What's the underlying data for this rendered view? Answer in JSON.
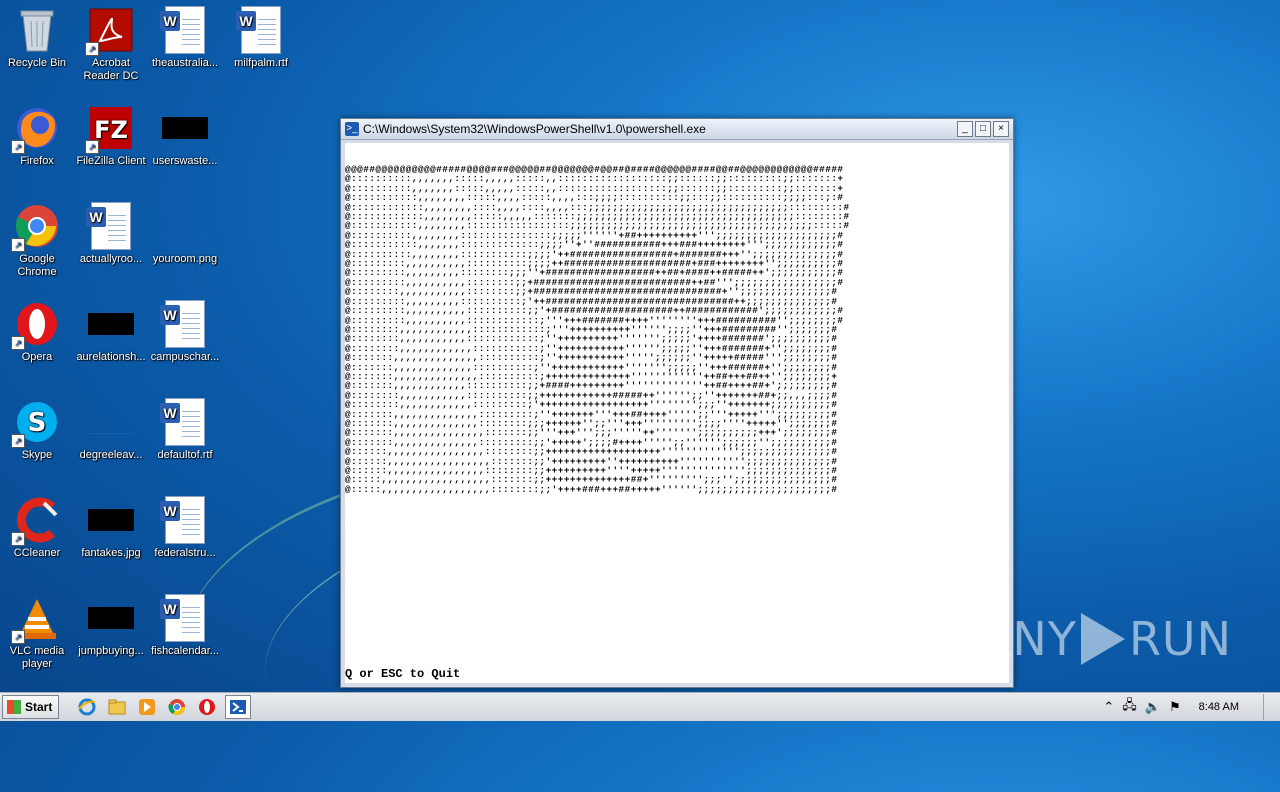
{
  "desktop": {
    "icons": [
      {
        "label": "Recycle Bin",
        "icon": "recycle-bin-icon"
      },
      {
        "label": "Acrobat Reader DC",
        "icon": "acrobat-icon"
      },
      {
        "label": "theaustralia...",
        "icon": "word-doc-icon"
      },
      {
        "label": "milfpalm.rtf",
        "icon": "word-doc-icon"
      },
      {
        "label": "Firefox",
        "icon": "firefox-icon"
      },
      {
        "label": "FileZilla Client",
        "icon": "filezilla-icon"
      },
      {
        "label": "userswaste...",
        "icon": "redacted-icon"
      },
      {
        "label": "Google Chrome",
        "icon": "chrome-icon"
      },
      {
        "label": "actuallyroo...",
        "icon": "word-doc-icon"
      },
      {
        "label": "youroom.png",
        "icon": "image-icon"
      },
      {
        "label": "Opera",
        "icon": "opera-icon"
      },
      {
        "label": "aurelationsh...",
        "icon": "redacted-icon"
      },
      {
        "label": "campuschar...",
        "icon": "word-doc-icon"
      },
      {
        "label": "Skype",
        "icon": "skype-icon"
      },
      {
        "label": "degreeleav...",
        "icon": "image-icon"
      },
      {
        "label": "defaultof.rtf",
        "icon": "word-doc-icon"
      },
      {
        "label": "CCleaner",
        "icon": "ccleaner-icon"
      },
      {
        "label": "fantakes.jpg",
        "icon": "redacted-icon"
      },
      {
        "label": "federalstru...",
        "icon": "word-doc-icon"
      },
      {
        "label": "VLC media player",
        "icon": "vlc-icon"
      },
      {
        "label": "jumpbuying...",
        "icon": "redacted-icon"
      },
      {
        "label": "fishcalendar...",
        "icon": "word-doc-icon"
      }
    ]
  },
  "window": {
    "title": "C:\\Windows\\System32\\WindowsPowerShell\\v1.0\\powershell.exe",
    "minimize": "_",
    "maximize": "□",
    "close": "×",
    "console_art": "@@@##@@@@@@@@@@#####@@@@###@@@@@##@@@@@@@#@@##@####@@@@@@####@@##@@@@@@@@@@@@#####\n@::::::::::,,,,,,,:::::,,,,,:::::,,::::::::::::::::::;;::::::;;:::::::::;;:::::::+\n@::::::::::,,,,,,,:::::,,,,,:::::,,::::::::::::::::::;;::::::;;:::::::::;;:::::::+\n@:::::::::::,,,,,,,,:::::,,,,:::::,,,,:::;;;;::::::::::;;:::;;::::::::::;;;;:::;:#\n@::::::::::::,,,,,,,,::::,,,,::::,,,,:::;;;;;;;;;;;;;;;;;;;;;;;;;;;;;;;;;:::::::::#\n@::::::::::::,,,,,,,,:::::,,,,,:::::::;;;;;;;;;;;;;;;;;;;;;;;;;;;;;;;;;;;;::::::::#\n@:::::::::::,,,,,,,,:::::::::::::::::;;;;;;;;;;;;;;;;;;;;;;;;;;;;;;;;;;;;;;;;:::::#\n@::::::::::,,,,,,,,:::::::::::::::;;;;;''''''+##++++++++++''';;;;;;;;;;;;;;;;;;;;#\n@:::::::::::,,,,,,,:::::::::::::;;;;''+''###########+++###++++++++''';;;;;;;;;;;;#\n@::::::::::,,,,,,,,:::::::::::;;;;'++#################+#######+++'';;;;;;;;;;;;;;#\n@:::::::::,,,,,,,,,,::::::::::;;;;++#####################+###++++++++'';;;;;;;;;;#\n@:::::::::,,,,,,,,,::::::::;;;''+##################++##+####++#####++';;;;;;;;;;;#\n@:::::::::,,,,,,,,,,::::::::;;+##########################++##''';;;;;;;;;;;;;;;;;#\n@::::::::,,,,,,,,,,,::::::::;;+###############################+'';;;;;;;;;;;;;;;#\n@:::::::::,,,,,,,,,::::::::::;'++###############################++;;;;;;;;;;;;;;#\n@:::::::::,,,,,,,,,,::::::::::;;'+####################++############';;;;;;;;;;;;#\n@:::::::::,,,,,,,,,,::::::::::::;'''+++#######++++''''''''+++##########'';;;;;;;;#\n@::::::::,,,,,,,,,,,,::::::::::::;'''++++++++++'''''';;;;''+++#########'';;;;;;;#\n@::::::::,,,,,,,,,,,::::::::::::;''++++++++++''''''';;;;;'++++#######';;;;;;;;;;#\n@::::::::,,,,,,,,,,,,:::::::::::;''+++++++++++'''''';;;;;''+++#######+'';;;;;;;;#\n@:::::::,,,,,,,,,,,,,,::::::::::;''+++++++++++''''';;;;;;''+++++#####''';;;;;;;;#\n@:::::::,,,,,,,,,,,,,::::::::::;''++++++++++++''''''';;;;;''+++######+'';;;;;;;;#\n@:::::::,,,,,,,,,,,,,,::::::::::;++++++++++++++''''''''''''++##+++##++'';;;;;;;;+\n@:::::::,,,,,,,,,,,,::::::::::;;+####+++++++++'''''''''''''++##++++##+';;;;;;;;;#\n@::::::::,,,,,,,,,,,::::::::::;;++++++++++++#####++'''''';;''+++++++##+;;,,,;;;;#\n@::::::::,,,,,,,,,,,,:::::::::;'++++++++++++++++++'''''''';;;''+++++++;;;;;;;;;;#\n@:::::::,,,,,,,,,,,,,,:::::::::;''+++++++'''+++##++++''''';;'''+++++''';;;;;;;;;#\n@:::::::,,,,,,,,,,,,,,::::::::;;;++++++'';;'''+++''''''''';;;;''''+++++'';;;;;;;#\n@:::::::,,,,,,,,,,,,,,,:::::::;;'''+++''';;;'''''++''''''';;;;;;;;;;+++';;;;;;;;#\n@:::::::,,,,,,,,,,,,,,:::::::::;;'+++++';;;;#++++''''';;'''''';;;;;;'';;;;;;;;;;#\n@::::::,,,,,,,,,,,,,,,,::::::::;;+++++++++++++++++++''''''''''''';;;;;;;;;;;;;;;#\n@::::::,,,,,,,,,,,,,,,,,:::::::;;'+++++++++''++++++++++''''''''''';;;;;;;;;;;;;;#\n@::::::,,,,,,,,,,,,,,,,::::::::;;++++++++++''''+++++'''''''''''''';;;;;;;;;;;;;;#\n@:::::,,,,,,,,,,,,,,,,,,:::::::;;++++++++++++++##+''''''''';;;'';;;;;;;;;;;;;;;;#\n@:::::,,,,,,,,,,,,,,,,,,::::::::;;'++++###+++##+++++'''''';;;;;;;;;;;;;;;;;;;;;;#",
    "quit_prompt": "Q or ESC to Quit"
  },
  "watermark": {
    "left": "ANY",
    "right": "RUN"
  },
  "taskbar": {
    "start_label": "Start",
    "pinned": [
      {
        "icon": "ie-icon"
      },
      {
        "icon": "explorer-icon"
      },
      {
        "icon": "media-player-icon"
      },
      {
        "icon": "chrome-icon"
      },
      {
        "icon": "opera-icon"
      },
      {
        "icon": "powershell-icon"
      }
    ],
    "clock": "8:48 AM"
  }
}
